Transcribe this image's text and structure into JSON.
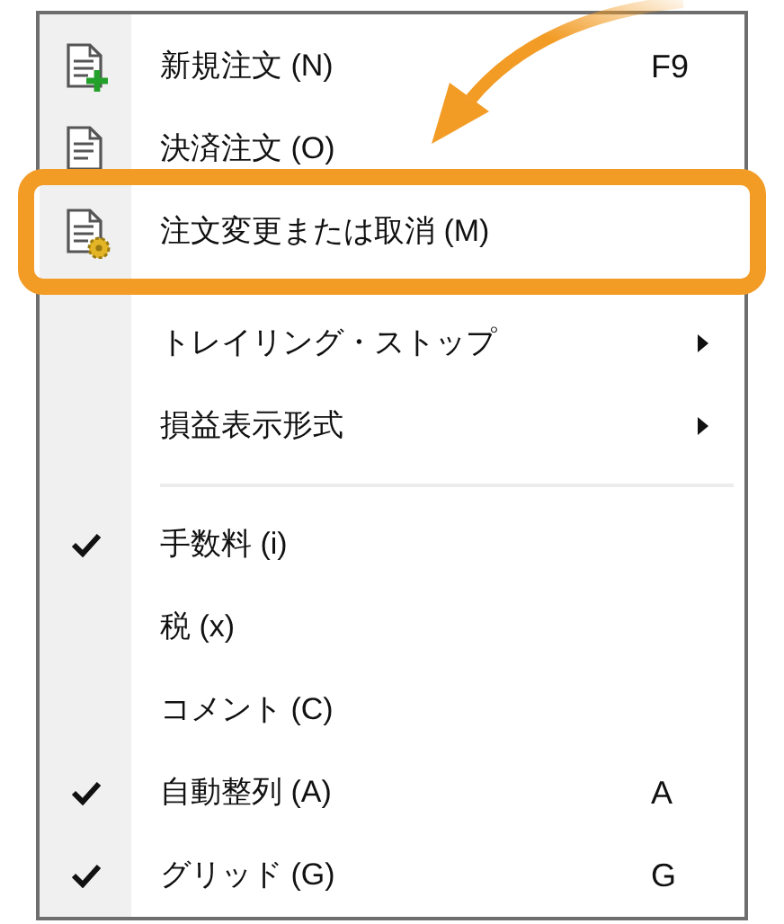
{
  "menu": {
    "items": [
      {
        "kind": "add",
        "label": "新規注文 (N)",
        "shortcut": "F9",
        "checked": false,
        "submenu": false,
        "selected": false
      },
      {
        "kind": "doc",
        "label": "決済注文 (O)",
        "checked": false,
        "submenu": false,
        "selected": false
      },
      {
        "kind": "gear",
        "label": "注文変更または取消 (M)",
        "checked": false,
        "submenu": false,
        "selected": true
      },
      {
        "kind": "plain",
        "label": "トレイリング・ストップ",
        "checked": false,
        "submenu": true,
        "selected": false
      },
      {
        "kind": "plain",
        "label": "損益表示形式",
        "checked": false,
        "submenu": true,
        "selected": false
      },
      {
        "kind": "separator"
      },
      {
        "kind": "plain",
        "label": "手数料 (i)",
        "checked": true,
        "submenu": false,
        "selected": false
      },
      {
        "kind": "plain",
        "label": "税 (x)",
        "checked": false,
        "submenu": false,
        "selected": false
      },
      {
        "kind": "plain",
        "label": "コメント (C)",
        "checked": false,
        "submenu": false,
        "selected": false
      },
      {
        "kind": "plain",
        "label": "自動整列 (A)",
        "shortcut": "A",
        "checked": true,
        "submenu": false,
        "selected": false
      },
      {
        "kind": "plain",
        "label": "グリッド (G)",
        "shortcut": "G",
        "checked": true,
        "submenu": false,
        "selected": false
      }
    ]
  }
}
